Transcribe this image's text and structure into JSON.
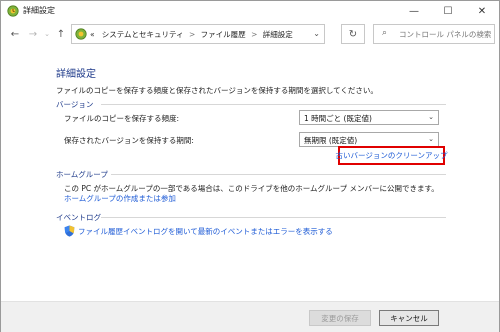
{
  "window": {
    "title": "詳細設定",
    "controls": {
      "minimize": "—",
      "maximize": "☐",
      "close": "✕"
    }
  },
  "nav": {
    "back": "←",
    "forward": "→",
    "up": "↑",
    "breadcrumb_prefix": "«",
    "breadcrumbs": [
      "システムとセキュリティ",
      "ファイル履歴",
      "詳細設定"
    ],
    "separator": ">",
    "dropdown": "⌄",
    "refresh": "↻",
    "search_icon": "⌕",
    "search_placeholder": "コントロール パネルの検索"
  },
  "main": {
    "title": "詳細設定",
    "description": "ファイルのコピーを保存する頻度と保存されたバージョンを保持する期間を選択してください。",
    "versions": {
      "heading": "バージョン",
      "copy_frequency_label": "ファイルのコピーを保存する頻度:",
      "copy_frequency_value": "1 時間ごと (既定値)",
      "keep_label": "保存されたバージョンを保持する期間:",
      "keep_value": "無期限 (既定値)",
      "cleanup_link": "古いバージョンのクリーンアップ"
    },
    "homegroup": {
      "heading": "ホームグループ",
      "text": "この PC がホームグループの一部である場合は、このドライブを他のホームグループ メンバーに公開できます。",
      "link": "ホームグループの作成または参加"
    },
    "eventlog": {
      "heading": "イベントログ",
      "link": "ファイル履歴イベントログを開いて最新のイベントまたはエラーを表示する"
    }
  },
  "footer": {
    "save_label": "変更の保存",
    "cancel_label": "キャンセル"
  },
  "colors": {
    "heading_blue": "#1e3a8a",
    "link_blue": "#1e5bd6",
    "highlight_red": "#e00000"
  }
}
